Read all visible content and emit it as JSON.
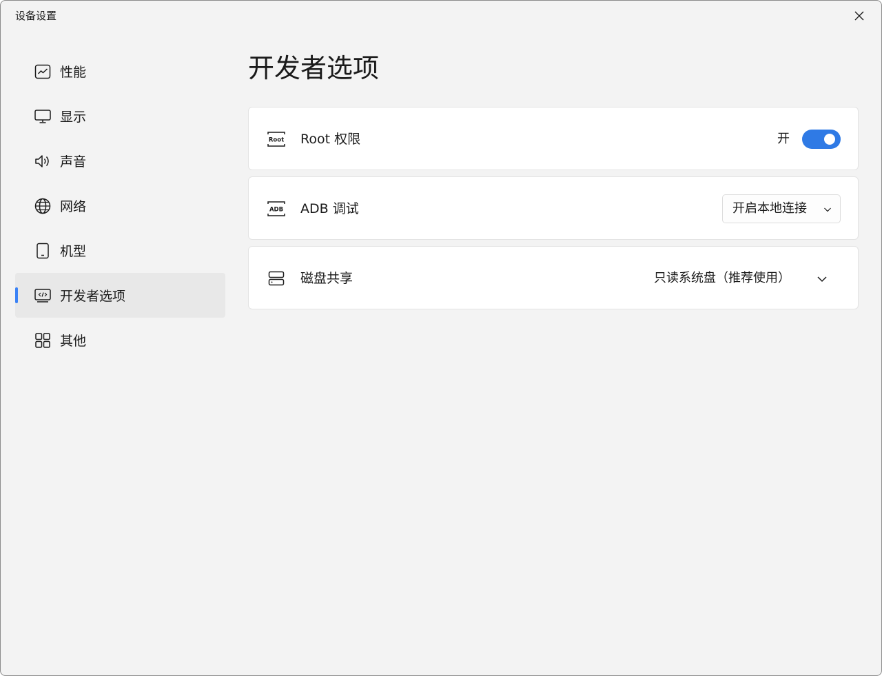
{
  "window": {
    "title": "设备设置"
  },
  "sidebar": {
    "items": [
      {
        "label": "性能",
        "icon": "chart-icon"
      },
      {
        "label": "显示",
        "icon": "monitor-icon"
      },
      {
        "label": "声音",
        "icon": "speaker-icon"
      },
      {
        "label": "网络",
        "icon": "globe-icon"
      },
      {
        "label": "机型",
        "icon": "tablet-icon"
      },
      {
        "label": "开发者选项",
        "icon": "code-screen-icon",
        "active": true
      },
      {
        "label": "其他",
        "icon": "grid-icon"
      }
    ]
  },
  "main": {
    "title": "开发者选项",
    "root": {
      "icon_text": "Root",
      "label": "Root 权限",
      "state_label": "开",
      "enabled": true
    },
    "adb": {
      "icon_text": "ADB",
      "label": "ADB 调试",
      "selected": "开启本地连接"
    },
    "disk": {
      "label": "磁盘共享",
      "selected": "只读系统盘（推荐使用）"
    }
  },
  "colors": {
    "accent": "#2f7ae5",
    "window_bg": "#f3f3f3",
    "card_bg": "#ffffff",
    "active_item_bg": "#e8e8e8"
  }
}
